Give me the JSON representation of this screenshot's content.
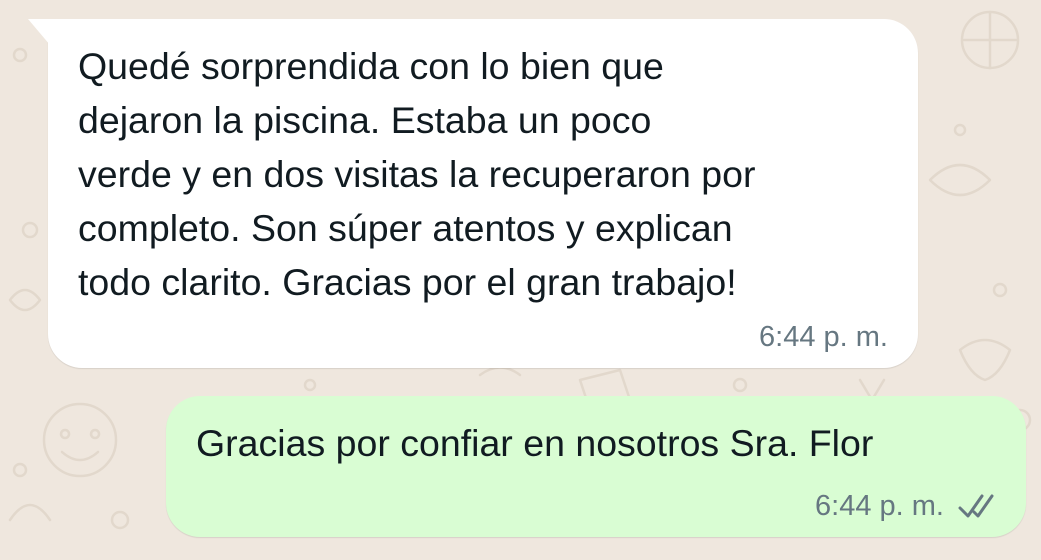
{
  "chat": {
    "incoming": {
      "text": "Quedé sorprendida con lo bien que\ndejaron la piscina. Estaba un poco\nverde y en dos visitas la recuperaron por\ncompleto. Son súper atentos y explican\ntodo clarito. Gracias por el gran trabajo!",
      "time": "6:44 p. m."
    },
    "outgoing": {
      "text": "Gracias por confiar en nosotros Sra. Flor",
      "time": "6:44 p. m.",
      "status_icon": "double-check-icon"
    }
  },
  "colors": {
    "background": "#efe7de",
    "incoming_bubble": "#ffffff",
    "outgoing_bubble": "#d9fdd3",
    "text": "#111b21",
    "meta": "#667781"
  }
}
